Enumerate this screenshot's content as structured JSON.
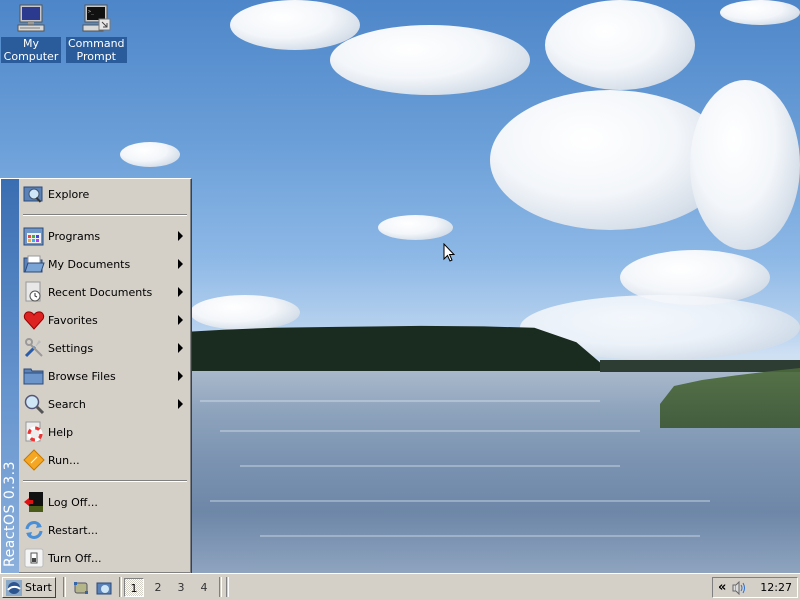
{
  "desktop": {
    "icons": [
      {
        "label": "My Computer",
        "icon": "computer-icon"
      },
      {
        "label": "Command Prompt",
        "icon": "command-prompt-icon"
      }
    ],
    "wallpaper": "lake-and-clouds"
  },
  "start_menu": {
    "banner_text": "ReactOS 0.3.3",
    "items": [
      {
        "label": "Explore",
        "icon": "explore-icon",
        "submenu": false
      },
      {
        "label": "Programs",
        "icon": "programs-icon",
        "submenu": true
      },
      {
        "label": "My Documents",
        "icon": "my-documents-icon",
        "submenu": true
      },
      {
        "label": "Recent Documents",
        "icon": "recent-documents-icon",
        "submenu": true
      },
      {
        "label": "Favorites",
        "icon": "favorites-icon",
        "submenu": true
      },
      {
        "label": "Settings",
        "icon": "settings-icon",
        "submenu": true
      },
      {
        "label": "Browse Files",
        "icon": "browse-files-icon",
        "submenu": true
      },
      {
        "label": "Search",
        "icon": "search-icon",
        "submenu": true
      },
      {
        "label": "Help",
        "icon": "help-icon",
        "submenu": false
      },
      {
        "label": "Run...",
        "icon": "run-icon",
        "submenu": false
      },
      {
        "label": "Log Off...",
        "icon": "log-off-icon",
        "submenu": false
      },
      {
        "label": "Restart...",
        "icon": "restart-icon",
        "submenu": false
      },
      {
        "label": "Turn Off...",
        "icon": "turn-off-icon",
        "submenu": false
      }
    ]
  },
  "taskbar": {
    "start_label": "Start",
    "quick_launch": [
      {
        "icon": "show-desktop-icon"
      },
      {
        "icon": "explorer-icon"
      }
    ],
    "workspaces": [
      "1",
      "2",
      "3",
      "4"
    ],
    "active_workspace": "1",
    "tray": {
      "expand_label": "«",
      "volume_icon": "volume-icon",
      "clock": "12:27"
    }
  },
  "colors": {
    "menu_bg": "#d4d0c8",
    "banner": "#3a6eb2",
    "icon_label_bg": "#2a5c9c"
  }
}
